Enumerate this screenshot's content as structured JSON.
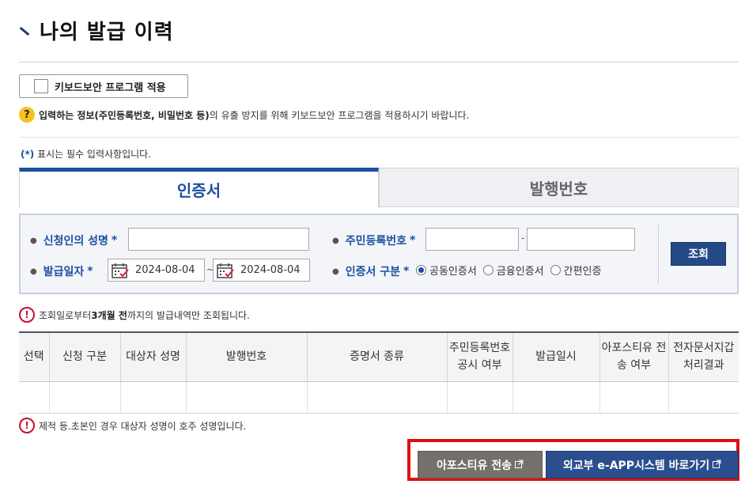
{
  "page": {
    "title": "나의 발급 이력"
  },
  "keyboard_security": {
    "label": "키보드보안 프로그램 적용",
    "notice_pre": "입력하는 정보",
    "notice_bold": "(주민등록번호, 비밀번호 등)",
    "notice_post": "의 유출 방지를 위해 키보드보안 프로그램을 적용하시기 바랍니다."
  },
  "required_note": {
    "star": "(*)",
    "text": "표시는 필수 입력사항입니다."
  },
  "tabs": [
    {
      "label": "인증서",
      "active": true
    },
    {
      "label": "발행번호",
      "active": false
    }
  ],
  "form": {
    "applicant_name_label": "신청인의 성명",
    "resident_number_label": "주민등록번호",
    "issue_date_label": "발급일자",
    "cert_type_label": "인증서 구분",
    "required_mark": "*",
    "date_from": "2024-08-04",
    "date_to": "2024-08-04",
    "date_separator": "~",
    "resident_separator": "-",
    "cert_options": [
      "공동인증서",
      "금융인증서",
      "간편인증"
    ],
    "cert_selected": "공동인증서",
    "search_button": "조회"
  },
  "query_notice": {
    "pre": "조회일로부터 ",
    "bold": "3개월 전",
    "post": "까지의 발급내역만 조회됩니다."
  },
  "table": {
    "headers": [
      "선택",
      "신청 구분",
      "대상자 성명",
      "발행번호",
      "증명서 종류",
      "주민등록번호 공시 여부",
      "발급일시",
      "아포스티유 전송 여부",
      "전자문서지갑 처리결과"
    ],
    "rows": []
  },
  "passport_notice": {
    "text": "제적 등.초본인 경우 대상자 성명이 호주 성명입니다."
  },
  "buttons": {
    "apostille": "아포스티유 전송",
    "mofa": "외교부 e-APP시스템 바로가기"
  },
  "colors": {
    "accent": "#1d4fa0",
    "highlight": "#e01010",
    "btn_gray": "#75706a",
    "btn_blue": "#2b4f8e"
  }
}
